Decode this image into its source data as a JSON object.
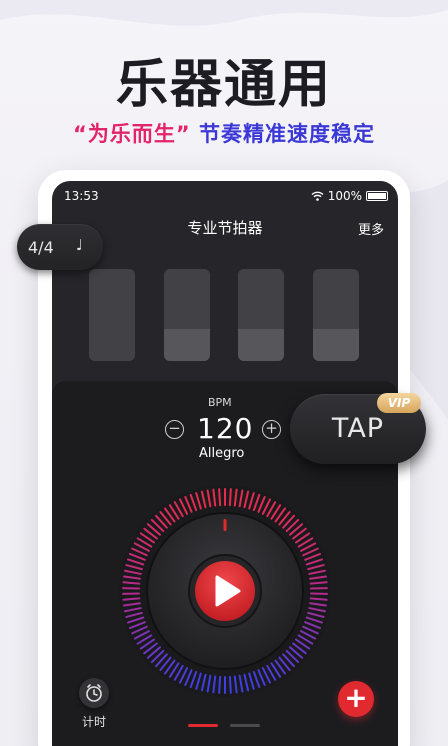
{
  "promo": {
    "headline": "乐器通用",
    "tagline_quote": "“为乐而生”",
    "tagline_text": "节奏精准速度稳定"
  },
  "status_bar": {
    "time": "13:53",
    "battery": "100%"
  },
  "app": {
    "title": "专业节拍器",
    "more_label": "更多"
  },
  "beat_indicators": [
    {
      "active": false,
      "level": 1.0
    },
    {
      "active": false,
      "level": 0.35
    },
    {
      "active": false,
      "level": 0.35
    },
    {
      "active": false,
      "level": 0.35
    }
  ],
  "controls": {
    "time_signature": "4/4",
    "note_icon": "quarter-note-icon",
    "bpm_label": "BPM",
    "bpm_value": "120",
    "tempo_name": "Allegro",
    "decrease_icon": "minus-circle-icon",
    "increase_icon": "plus-circle-icon",
    "tap_label": "TAP",
    "vip_label": "VIP",
    "play_icon": "play-icon",
    "timer_label": "计时",
    "add_icon": "plus-icon"
  },
  "page_indicator": {
    "count": 2,
    "current": 0
  },
  "colors": {
    "accent_red": "#e12a2f",
    "tagline_pink": "#e2246a",
    "tagline_blue": "#3b38d6",
    "vip_gold": "#e0b36e"
  }
}
